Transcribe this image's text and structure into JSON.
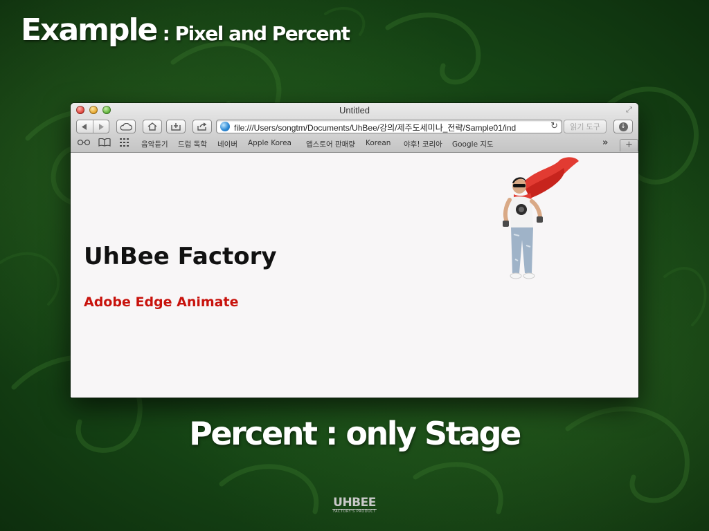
{
  "slide": {
    "title_main": "Example",
    "title_sub": " : Pixel and Percent",
    "caption": "Percent : only Stage",
    "footer_brand": "UHBEE",
    "footer_tag": "FACTORY'S PRODUCT",
    "background_color": "#164515"
  },
  "browser": {
    "window_title": "Untitled",
    "url": "file:///Users/songtm/Documents/UhBee/강의/제주도세미나_전략/Sample01/ind",
    "reader_label": "읽기 도구",
    "icons": {
      "back": "back-arrow-icon",
      "forward": "forward-arrow-icon",
      "icloud": "cloud-icon",
      "home": "home-icon",
      "add_bookmark": "add-bookmark-icon",
      "share": "share-icon",
      "reload": "reload-icon",
      "download": "download-icon",
      "reading_list": "glasses-icon",
      "bookmarks": "book-icon",
      "top_sites": "grid-icon"
    },
    "bookmarks": [
      "음악듣기",
      "드럼 독학",
      "네이버",
      "Apple Korea",
      "앱스토어 판매량",
      "Korean",
      "야후! 코리아",
      "Google 지도"
    ]
  },
  "page": {
    "heading": "UhBee Factory",
    "subheading": "Adobe Edge Animate",
    "subheading_color": "#c8120c"
  }
}
